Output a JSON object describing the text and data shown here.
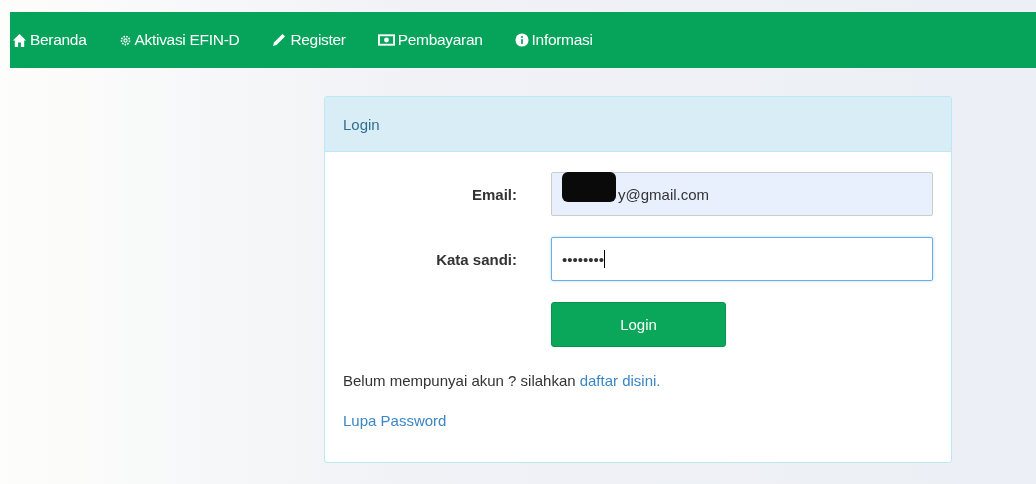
{
  "nav": {
    "items": [
      {
        "label": "Beranda"
      },
      {
        "label": "Aktivasi EFIN-D"
      },
      {
        "label": "Register"
      },
      {
        "label": "Pembayaran"
      },
      {
        "label": "Informasi"
      }
    ]
  },
  "login_panel": {
    "title": "Login",
    "fields": [
      {
        "label": "Email:",
        "value": "y@gmail.com",
        "redacted": true,
        "focused": false
      },
      {
        "label": "Kata sandi:",
        "value": "••••••••",
        "redacted": false,
        "focused": true
      }
    ],
    "submit": "Login",
    "signup_prompt": "Belum mempunyai akun ? silahkan",
    "signup_link": "daftar disini.",
    "forgot_link": "Lupa Password"
  }
}
